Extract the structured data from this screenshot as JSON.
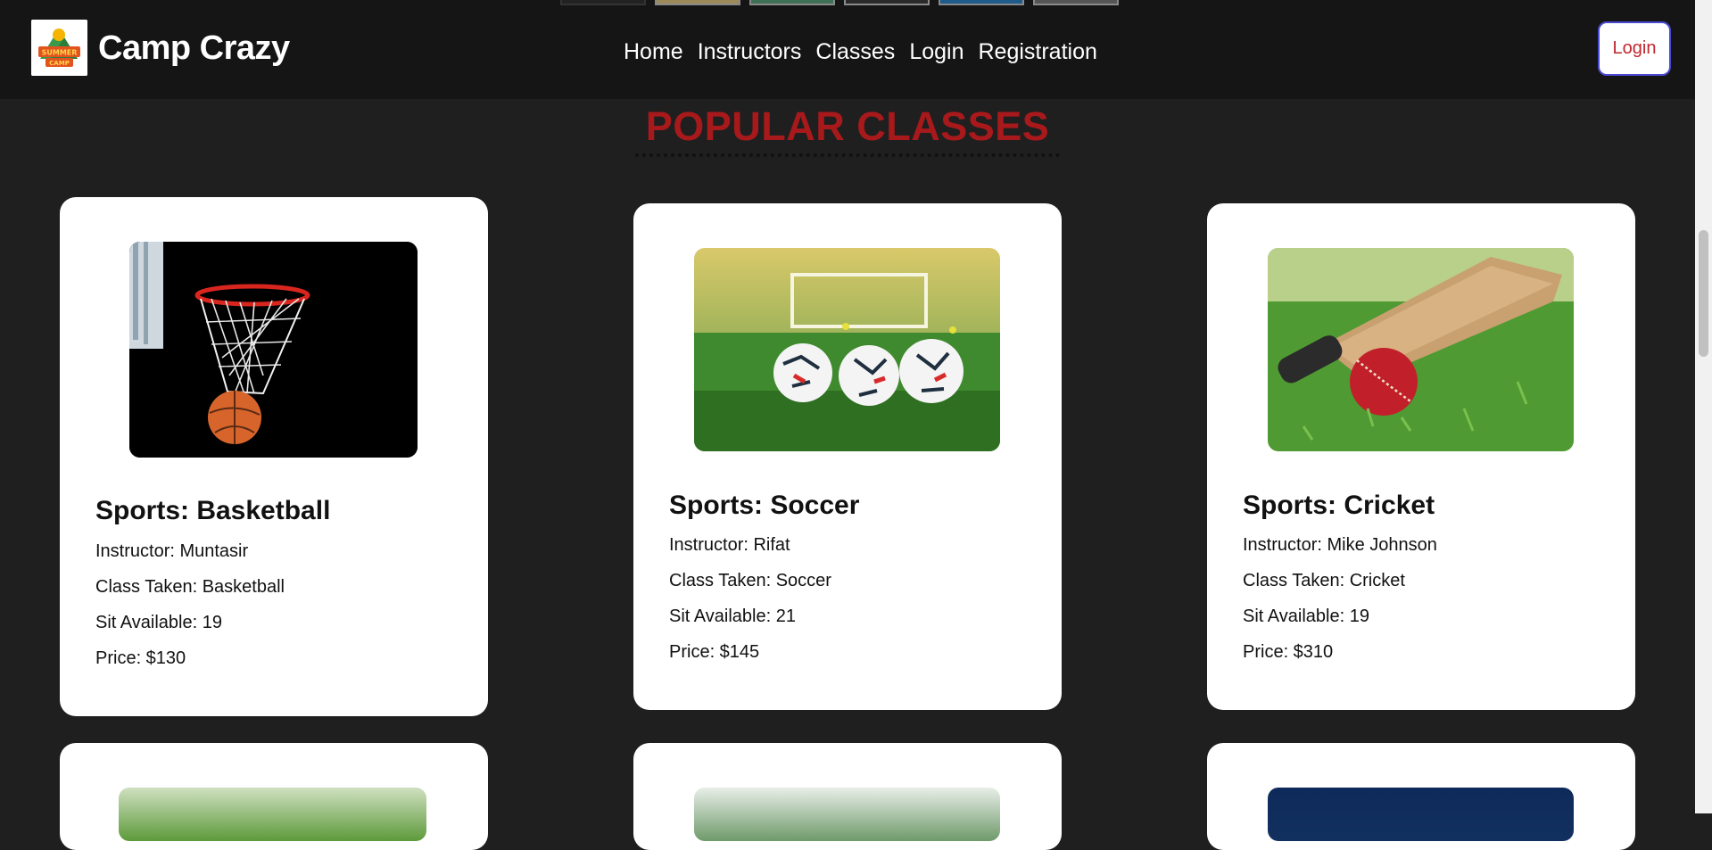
{
  "brand": {
    "name": "Camp Crazy",
    "logo_text_top": "SUMMER",
    "logo_text_bottom": "CAMP"
  },
  "nav": {
    "items": [
      "Home",
      "Instructors",
      "Classes",
      "Login",
      "Registration"
    ],
    "login_button": "Login"
  },
  "section": {
    "title": "POPULAR CLASSES"
  },
  "colors": {
    "accent": "#a8191c",
    "navbar": "#151515",
    "background": "#1f1f1f"
  },
  "classes": [
    {
      "title": "Sports: Basketball",
      "instructor": "Instructor: Muntasir",
      "class_taken": "Class Taken: Basketball",
      "seats": "Sit Available: 19",
      "price": "Price: $130",
      "image": "basketball-hoop-image"
    },
    {
      "title": "Sports: Soccer",
      "instructor": "Instructor: Rifat",
      "class_taken": "Class Taken: Soccer",
      "seats": "Sit Available: 21",
      "price": "Price: $145",
      "image": "soccer-balls-image"
    },
    {
      "title": "Sports: Cricket",
      "instructor": "Instructor: Mike Johnson",
      "class_taken": "Class Taken: Cricket",
      "seats": "Sit Available: 19",
      "price": "Price: $310",
      "image": "cricket-bat-ball-image"
    }
  ]
}
